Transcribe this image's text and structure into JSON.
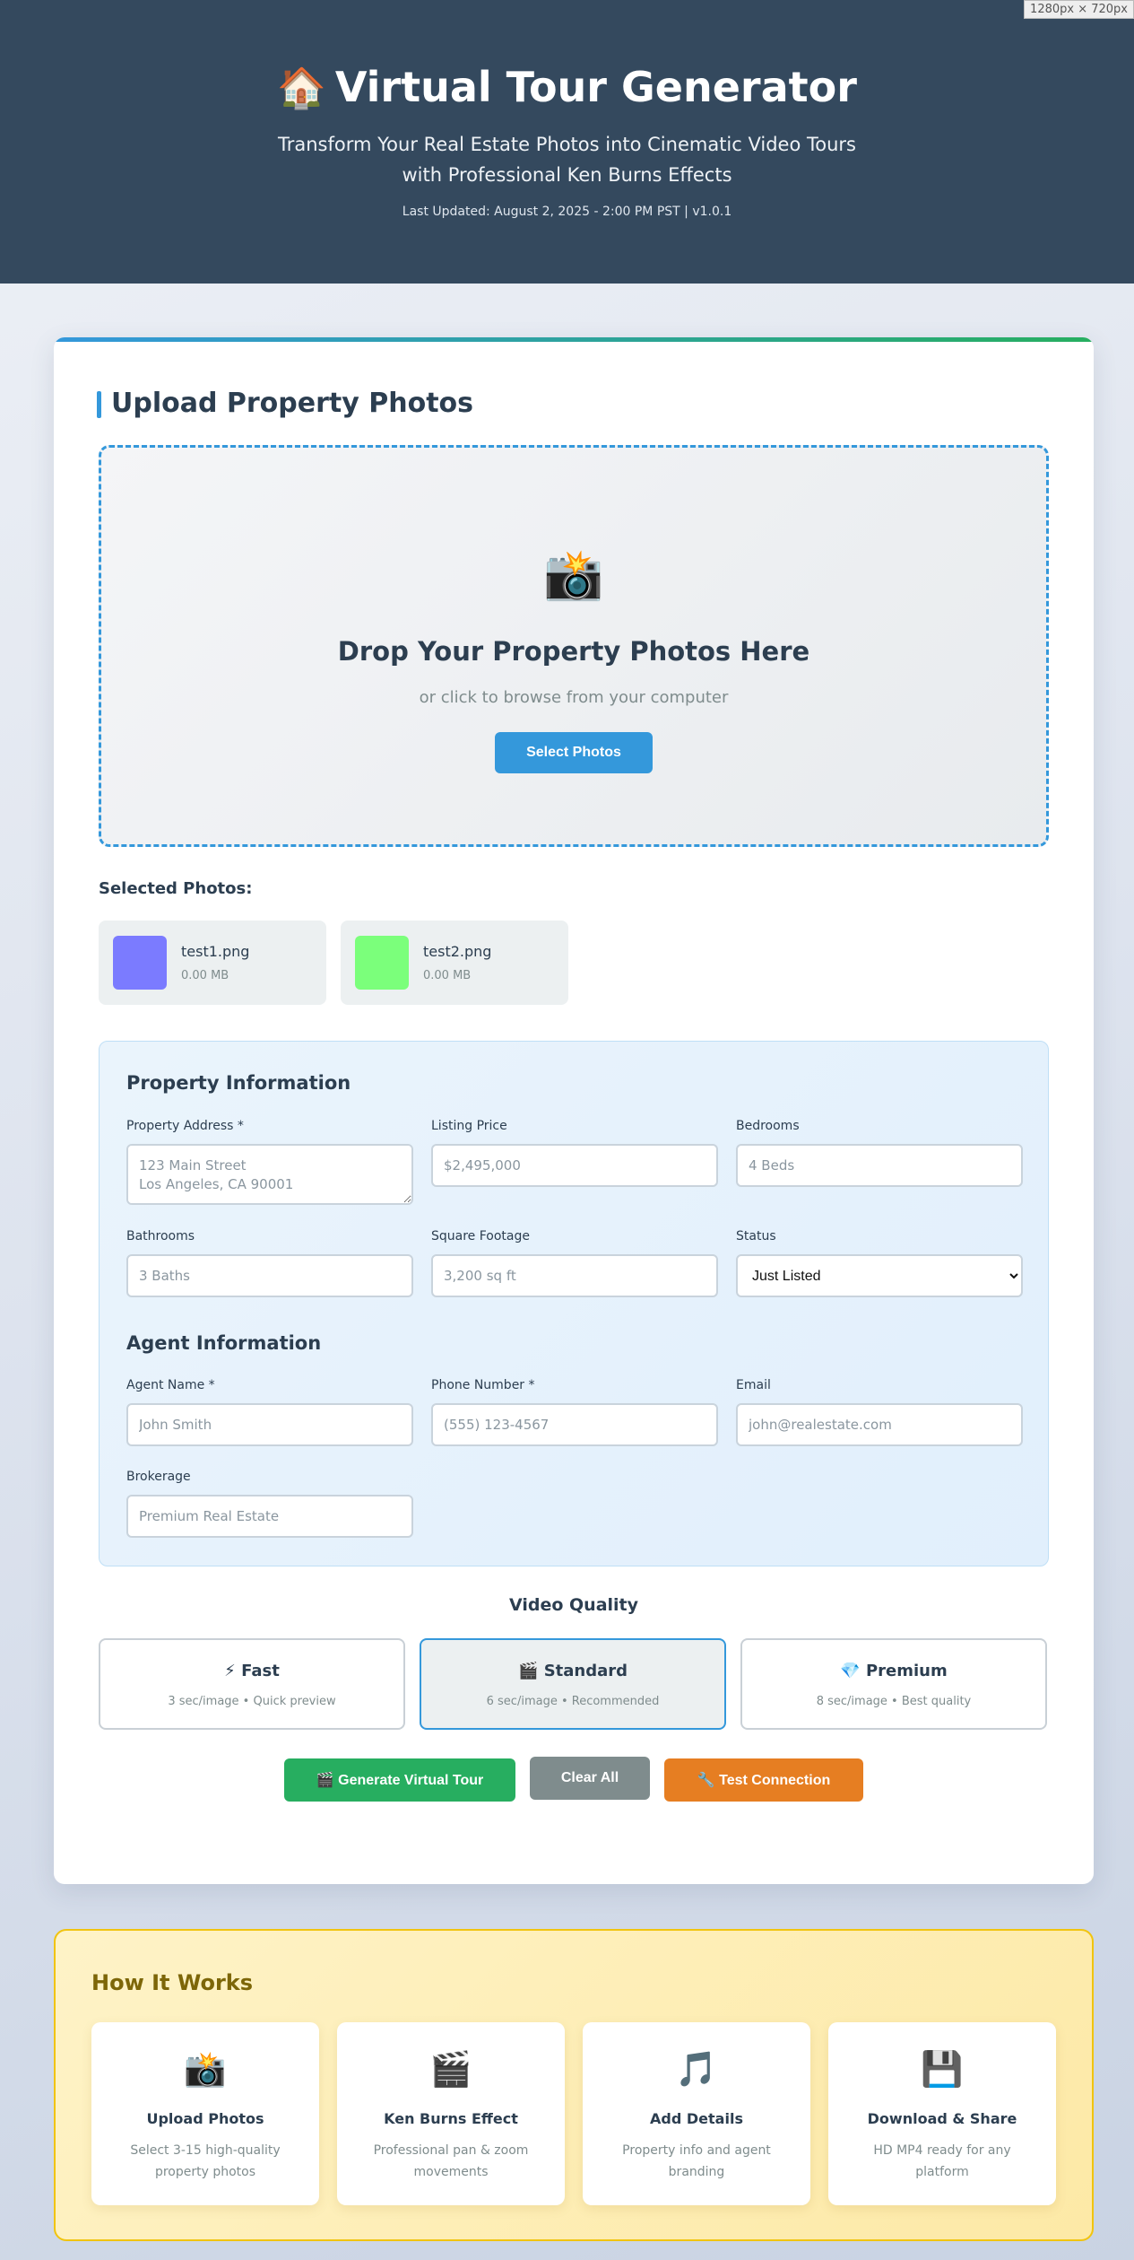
{
  "viewport_badge": "1280px × 720px",
  "header": {
    "icon": "🏠",
    "title": "Virtual Tour Generator",
    "subtitle_line1": "Transform Your Real Estate Photos into Cinematic Video Tours",
    "subtitle_line2": "with Professional Ken Burns Effects",
    "updated": "Last Updated: August 2, 2025 - 2:00 PM PST | v1.0.1",
    "bg_color": "#34495e"
  },
  "upload": {
    "title": "Upload Property Photos",
    "drop_icon": "📸",
    "drop_title": "Drop Your Property Photos Here",
    "drop_subtitle": "or click to browse from your computer",
    "select_button": "Select Photos",
    "selected_label": "Selected Photos:",
    "files": [
      {
        "name": "test1.png",
        "size": "0.00 MB",
        "color": "#7b7bff"
      },
      {
        "name": "test2.png",
        "size": "0.00 MB",
        "color": "#7bff7b"
      }
    ]
  },
  "property": {
    "title": "Property Information",
    "address_label": "Property Address *",
    "address_placeholder": "123 Main Street\nLos Angeles, CA 90001",
    "price_label": "Listing Price",
    "price_placeholder": "$2,495,000",
    "bedrooms_label": "Bedrooms",
    "bedrooms_placeholder": "4 Beds",
    "bathrooms_label": "Bathrooms",
    "bathrooms_placeholder": "3 Baths",
    "sqft_label": "Square Footage",
    "sqft_placeholder": "3,200 sq ft",
    "status_label": "Status",
    "status_value": "Just Listed"
  },
  "agent": {
    "title": "Agent Information",
    "name_label": "Agent Name *",
    "name_placeholder": "John Smith",
    "phone_label": "Phone Number *",
    "phone_placeholder": "(555) 123-4567",
    "email_label": "Email",
    "email_placeholder": "john@realestate.com",
    "brokerage_label": "Brokerage",
    "brokerage_placeholder": "Premium Real Estate"
  },
  "quality": {
    "title": "Video Quality",
    "options": [
      {
        "icon": "⚡",
        "name": "Fast",
        "desc": "3 sec/image • Quick preview"
      },
      {
        "icon": "🎬",
        "name": "Standard",
        "desc": "6 sec/image • Recommended"
      },
      {
        "icon": "💎",
        "name": "Premium",
        "desc": "8 sec/image • Best quality"
      }
    ],
    "selected": "Standard"
  },
  "actions": {
    "generate": "🎬 Generate Virtual Tour",
    "clear": "Clear All",
    "test": "🔧 Test Connection",
    "generate_color": "#27ae60",
    "clear_color": "#7f8c8d",
    "test_color": "#e67e22"
  },
  "how": {
    "title": "How It Works",
    "steps": [
      {
        "icon": "📸",
        "title": "Upload Photos",
        "desc": "Select 3-15 high-quality property photos"
      },
      {
        "icon": "🎬",
        "title": "Ken Burns Effect",
        "desc": "Professional pan & zoom movements"
      },
      {
        "icon": "🎵",
        "title": "Add Details",
        "desc": "Property info and agent branding"
      },
      {
        "icon": "💾",
        "title": "Download & Share",
        "desc": "HD MP4 ready for any platform"
      }
    ]
  }
}
